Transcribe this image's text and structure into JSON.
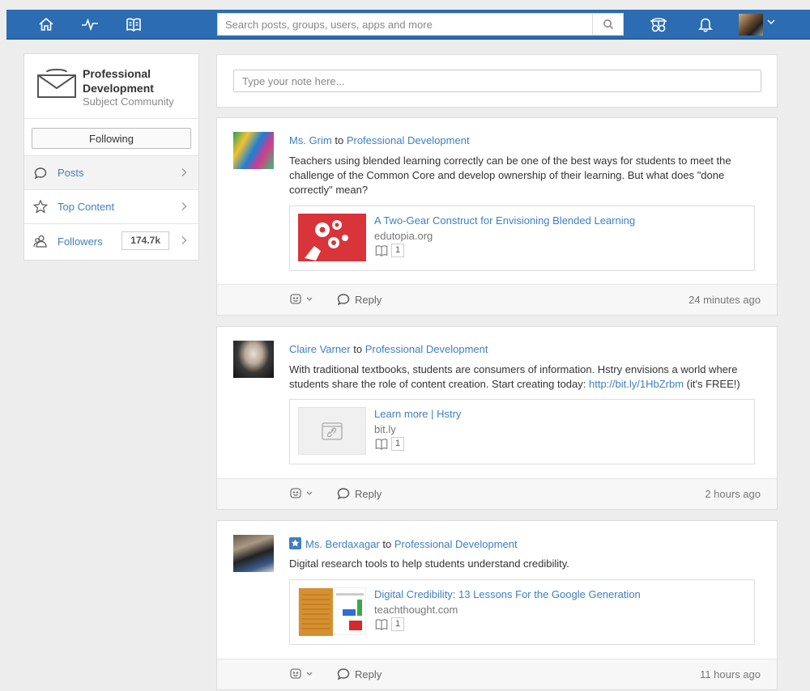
{
  "topbar": {
    "icons": [
      "home-icon",
      "activity-icon",
      "backpack-icon",
      "search-icon",
      "apps-icon",
      "bell-icon"
    ],
    "search_placeholder": "Search posts, groups, users, apps and more",
    "accent": "#2b6cb3"
  },
  "sidebar": {
    "title": "Professional Development",
    "subtitle": "Subject Community",
    "follow_label": "Following",
    "items": [
      {
        "label": "Posts",
        "icon": "speech-bubble-icon"
      },
      {
        "label": "Top Content",
        "icon": "star-outline-icon"
      },
      {
        "label": "Followers",
        "icon": "people-icon",
        "count": "174.7k"
      }
    ]
  },
  "composer": {
    "placeholder": "Type your note here..."
  },
  "posts": [
    {
      "author": "Ms. Grim",
      "to": "to",
      "group": "Professional Development",
      "text": "Teachers using blended learning correctly can be one of the best ways for students to meet the challenge of the Common Core and develop ownership of their learning. But what does \"done correctly\" mean?",
      "attachment": {
        "title": "A Two-Gear Construct for Envisioning Blended Learning",
        "source": "edutopia.org",
        "count": "1"
      },
      "reply_label": "Reply",
      "time": "24 minutes ago"
    },
    {
      "author": "Claire Varner",
      "to": "to",
      "group": "Professional Development",
      "text_before": "With traditional textbooks, students are consumers of information. Hstry envisions a world where students share the role of content creation. Start creating today: ",
      "text_link": "http://bit.ly/1HbZrbm",
      "text_after": " (it's FREE!)",
      "attachment": {
        "title": "Learn more | Hstry",
        "source": "bit.ly",
        "count": "1"
      },
      "reply_label": "Reply",
      "time": "2 hours ago"
    },
    {
      "author": "Ms. Berdaxagar",
      "to": "to",
      "group": "Professional Development",
      "text": "Digital research tools to help students understand credibility.",
      "attachment": {
        "title": "Digital Credibility: 13 Lessons For the Google Generation",
        "source": "teachthought.com",
        "count": "1"
      },
      "reply_label": "Reply",
      "time": "11 hours ago"
    }
  ]
}
